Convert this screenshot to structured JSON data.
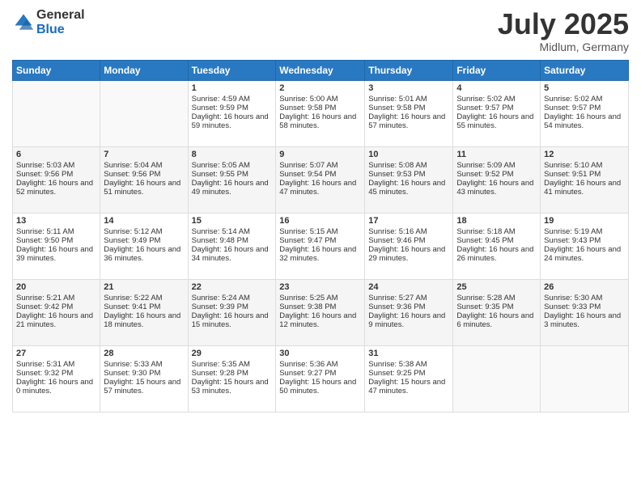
{
  "logo": {
    "general": "General",
    "blue": "Blue"
  },
  "title": "July 2025",
  "subtitle": "Midlum, Germany",
  "days_header": [
    "Sunday",
    "Monday",
    "Tuesday",
    "Wednesday",
    "Thursday",
    "Friday",
    "Saturday"
  ],
  "weeks": [
    [
      {
        "day": "",
        "sunrise": "",
        "sunset": "",
        "daylight": ""
      },
      {
        "day": "",
        "sunrise": "",
        "sunset": "",
        "daylight": ""
      },
      {
        "day": "1",
        "sunrise": "Sunrise: 4:59 AM",
        "sunset": "Sunset: 9:59 PM",
        "daylight": "Daylight: 16 hours and 59 minutes."
      },
      {
        "day": "2",
        "sunrise": "Sunrise: 5:00 AM",
        "sunset": "Sunset: 9:58 PM",
        "daylight": "Daylight: 16 hours and 58 minutes."
      },
      {
        "day": "3",
        "sunrise": "Sunrise: 5:01 AM",
        "sunset": "Sunset: 9:58 PM",
        "daylight": "Daylight: 16 hours and 57 minutes."
      },
      {
        "day": "4",
        "sunrise": "Sunrise: 5:02 AM",
        "sunset": "Sunset: 9:57 PM",
        "daylight": "Daylight: 16 hours and 55 minutes."
      },
      {
        "day": "5",
        "sunrise": "Sunrise: 5:02 AM",
        "sunset": "Sunset: 9:57 PM",
        "daylight": "Daylight: 16 hours and 54 minutes."
      }
    ],
    [
      {
        "day": "6",
        "sunrise": "Sunrise: 5:03 AM",
        "sunset": "Sunset: 9:56 PM",
        "daylight": "Daylight: 16 hours and 52 minutes."
      },
      {
        "day": "7",
        "sunrise": "Sunrise: 5:04 AM",
        "sunset": "Sunset: 9:56 PM",
        "daylight": "Daylight: 16 hours and 51 minutes."
      },
      {
        "day": "8",
        "sunrise": "Sunrise: 5:05 AM",
        "sunset": "Sunset: 9:55 PM",
        "daylight": "Daylight: 16 hours and 49 minutes."
      },
      {
        "day": "9",
        "sunrise": "Sunrise: 5:07 AM",
        "sunset": "Sunset: 9:54 PM",
        "daylight": "Daylight: 16 hours and 47 minutes."
      },
      {
        "day": "10",
        "sunrise": "Sunrise: 5:08 AM",
        "sunset": "Sunset: 9:53 PM",
        "daylight": "Daylight: 16 hours and 45 minutes."
      },
      {
        "day": "11",
        "sunrise": "Sunrise: 5:09 AM",
        "sunset": "Sunset: 9:52 PM",
        "daylight": "Daylight: 16 hours and 43 minutes."
      },
      {
        "day": "12",
        "sunrise": "Sunrise: 5:10 AM",
        "sunset": "Sunset: 9:51 PM",
        "daylight": "Daylight: 16 hours and 41 minutes."
      }
    ],
    [
      {
        "day": "13",
        "sunrise": "Sunrise: 5:11 AM",
        "sunset": "Sunset: 9:50 PM",
        "daylight": "Daylight: 16 hours and 39 minutes."
      },
      {
        "day": "14",
        "sunrise": "Sunrise: 5:12 AM",
        "sunset": "Sunset: 9:49 PM",
        "daylight": "Daylight: 16 hours and 36 minutes."
      },
      {
        "day": "15",
        "sunrise": "Sunrise: 5:14 AM",
        "sunset": "Sunset: 9:48 PM",
        "daylight": "Daylight: 16 hours and 34 minutes."
      },
      {
        "day": "16",
        "sunrise": "Sunrise: 5:15 AM",
        "sunset": "Sunset: 9:47 PM",
        "daylight": "Daylight: 16 hours and 32 minutes."
      },
      {
        "day": "17",
        "sunrise": "Sunrise: 5:16 AM",
        "sunset": "Sunset: 9:46 PM",
        "daylight": "Daylight: 16 hours and 29 minutes."
      },
      {
        "day": "18",
        "sunrise": "Sunrise: 5:18 AM",
        "sunset": "Sunset: 9:45 PM",
        "daylight": "Daylight: 16 hours and 26 minutes."
      },
      {
        "day": "19",
        "sunrise": "Sunrise: 5:19 AM",
        "sunset": "Sunset: 9:43 PM",
        "daylight": "Daylight: 16 hours and 24 minutes."
      }
    ],
    [
      {
        "day": "20",
        "sunrise": "Sunrise: 5:21 AM",
        "sunset": "Sunset: 9:42 PM",
        "daylight": "Daylight: 16 hours and 21 minutes."
      },
      {
        "day": "21",
        "sunrise": "Sunrise: 5:22 AM",
        "sunset": "Sunset: 9:41 PM",
        "daylight": "Daylight: 16 hours and 18 minutes."
      },
      {
        "day": "22",
        "sunrise": "Sunrise: 5:24 AM",
        "sunset": "Sunset: 9:39 PM",
        "daylight": "Daylight: 16 hours and 15 minutes."
      },
      {
        "day": "23",
        "sunrise": "Sunrise: 5:25 AM",
        "sunset": "Sunset: 9:38 PM",
        "daylight": "Daylight: 16 hours and 12 minutes."
      },
      {
        "day": "24",
        "sunrise": "Sunrise: 5:27 AM",
        "sunset": "Sunset: 9:36 PM",
        "daylight": "Daylight: 16 hours and 9 minutes."
      },
      {
        "day": "25",
        "sunrise": "Sunrise: 5:28 AM",
        "sunset": "Sunset: 9:35 PM",
        "daylight": "Daylight: 16 hours and 6 minutes."
      },
      {
        "day": "26",
        "sunrise": "Sunrise: 5:30 AM",
        "sunset": "Sunset: 9:33 PM",
        "daylight": "Daylight: 16 hours and 3 minutes."
      }
    ],
    [
      {
        "day": "27",
        "sunrise": "Sunrise: 5:31 AM",
        "sunset": "Sunset: 9:32 PM",
        "daylight": "Daylight: 16 hours and 0 minutes."
      },
      {
        "day": "28",
        "sunrise": "Sunrise: 5:33 AM",
        "sunset": "Sunset: 9:30 PM",
        "daylight": "Daylight: 15 hours and 57 minutes."
      },
      {
        "day": "29",
        "sunrise": "Sunrise: 5:35 AM",
        "sunset": "Sunset: 9:28 PM",
        "daylight": "Daylight: 15 hours and 53 minutes."
      },
      {
        "day": "30",
        "sunrise": "Sunrise: 5:36 AM",
        "sunset": "Sunset: 9:27 PM",
        "daylight": "Daylight: 15 hours and 50 minutes."
      },
      {
        "day": "31",
        "sunrise": "Sunrise: 5:38 AM",
        "sunset": "Sunset: 9:25 PM",
        "daylight": "Daylight: 15 hours and 47 minutes."
      },
      {
        "day": "",
        "sunrise": "",
        "sunset": "",
        "daylight": ""
      },
      {
        "day": "",
        "sunrise": "",
        "sunset": "",
        "daylight": ""
      }
    ]
  ]
}
